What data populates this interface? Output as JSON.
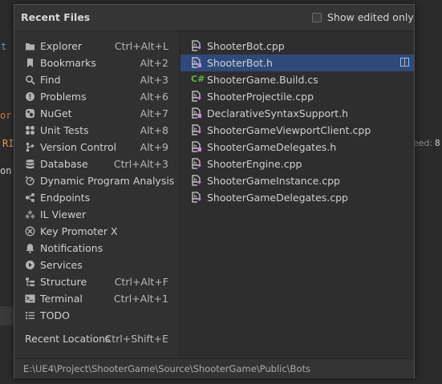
{
  "background": {
    "frag_t": "t",
    "frag_or": "or",
    "frag_ri": "RI",
    "frag_on": "on,",
    "frag_eed": "eed:",
    "frag_eed_val": "8"
  },
  "popup": {
    "title": "Recent Files",
    "show_edited_label": "Show edited only",
    "show_edited_checked": false
  },
  "tool_windows": [
    {
      "label": "Explorer",
      "shortcut": "Ctrl+Alt+L",
      "icon": "folder-icon"
    },
    {
      "label": "Bookmarks",
      "shortcut": "Alt+2",
      "icon": "bookmark-icon"
    },
    {
      "label": "Find",
      "shortcut": "Alt+3",
      "icon": "search-icon"
    },
    {
      "label": "Problems",
      "shortcut": "Alt+6",
      "icon": "problems-icon"
    },
    {
      "label": "NuGet",
      "shortcut": "Alt+7",
      "icon": "nuget-icon"
    },
    {
      "label": "Unit Tests",
      "shortcut": "Alt+8",
      "icon": "unit-tests-icon"
    },
    {
      "label": "Version Control",
      "shortcut": "Alt+9",
      "icon": "version-control-icon"
    },
    {
      "label": "Database",
      "shortcut": "Ctrl+Alt+3",
      "icon": "database-icon"
    },
    {
      "label": "Dynamic Program Analysis",
      "shortcut": "",
      "icon": "dpa-icon"
    },
    {
      "label": "Endpoints",
      "shortcut": "",
      "icon": "endpoints-icon"
    },
    {
      "label": "IL Viewer",
      "shortcut": "",
      "icon": "il-viewer-icon"
    },
    {
      "label": "Key Promoter X",
      "shortcut": "",
      "icon": "key-promoter-icon"
    },
    {
      "label": "Notifications",
      "shortcut": "",
      "icon": "bell-icon"
    },
    {
      "label": "Services",
      "shortcut": "",
      "icon": "services-icon"
    },
    {
      "label": "Structure",
      "shortcut": "Ctrl+Alt+F",
      "icon": "structure-icon"
    },
    {
      "label": "Terminal",
      "shortcut": "Ctrl+Alt+1",
      "icon": "terminal-icon"
    },
    {
      "label": "TODO",
      "shortcut": "",
      "icon": "todo-icon"
    }
  ],
  "recent_locations": {
    "label": "Recent Locations",
    "shortcut": "Ctrl+Shift+E"
  },
  "recent_files": [
    {
      "name": "ShooterBot.cpp",
      "type": "cpp",
      "selected": false
    },
    {
      "name": "ShooterBot.h",
      "type": "h",
      "selected": true
    },
    {
      "name": "ShooterGame.Build.cs",
      "type": "cs",
      "selected": false
    },
    {
      "name": "ShooterProjectile.cpp",
      "type": "cpp",
      "selected": false
    },
    {
      "name": "DeclarativeSyntaxSupport.h",
      "type": "h",
      "selected": false
    },
    {
      "name": "ShooterGameViewportClient.cpp",
      "type": "cpp",
      "selected": false
    },
    {
      "name": "ShooterGameDelegates.h",
      "type": "h",
      "selected": false
    },
    {
      "name": "ShooterEngine.cpp",
      "type": "cpp",
      "selected": false
    },
    {
      "name": "ShooterGameInstance.cpp",
      "type": "cpp",
      "selected": false
    },
    {
      "name": "ShooterGameDelegates.cpp",
      "type": "cpp",
      "selected": false
    }
  ],
  "footer": {
    "path": "E:\\UE4\\Project\\ShooterGame\\Source\\ShooterGame\\Public\\Bots"
  },
  "colors": {
    "selection": "#2f4a7a",
    "cpp_icon": "#c38bd8",
    "cs_icon": "#62b543"
  }
}
